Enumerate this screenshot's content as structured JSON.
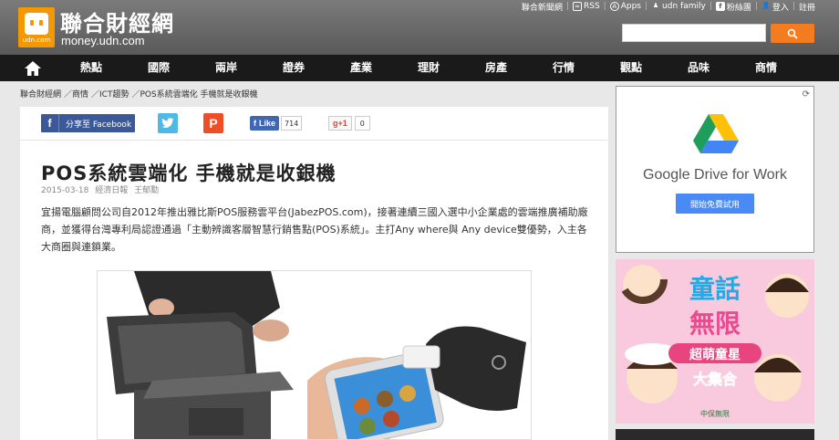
{
  "header": {
    "logo_cn": "聯合財經網",
    "logo_en": "money.udn.com",
    "logo_mini": "udn.com",
    "top_links": [
      "聯合新聞網",
      "RSS",
      "Apps",
      "udn family",
      "粉絲團",
      "登入",
      "註冊"
    ],
    "search_placeholder": ""
  },
  "nav": {
    "items": [
      "熱點",
      "國際",
      "兩岸",
      "證券",
      "產業",
      "理財",
      "房產",
      "行情",
      "觀點",
      "品味",
      "商情"
    ]
  },
  "breadcrumb": [
    "聯合財經網",
    "／商情",
    "／ICT趨勢",
    "／POS系統雲端化 手機就是收銀機"
  ],
  "share": {
    "facebook_label": "分享至 Facebook",
    "like_label": "Like",
    "like_count": "714",
    "gplus_label": "g+1",
    "gplus_count": "0"
  },
  "article": {
    "title": "POS系統雲端化 手機就是收銀機",
    "date": "2015-03-18",
    "source": "經濟日報",
    "author": "王郁勳",
    "body": "宜揚電腦顧問公司自2012年推出雅比斯POS服務雲平台(JabezPOS.com)，接著連續三國入選中小企業處的雲端推廣補助廠商，並獲得台灣專利局認證通過「主動辨識客層智慧行銷售點(POS)系統」。主打Any where與 Any device雙優勢，入主各大商圈與連鎖業。"
  },
  "ads": {
    "drive_text": "Google Drive for Work",
    "drive_button": "開始免費試用",
    "kids_line1": "童話",
    "kids_line2": "無限",
    "kids_line3": "超萌童星",
    "kids_line4": "大集合",
    "kids_brand": "中保無限"
  },
  "colors": {
    "accent": "#f39800",
    "search_button": "#f47c20",
    "nav_bg": "#1a1a1a",
    "facebook": "#3b5998"
  }
}
